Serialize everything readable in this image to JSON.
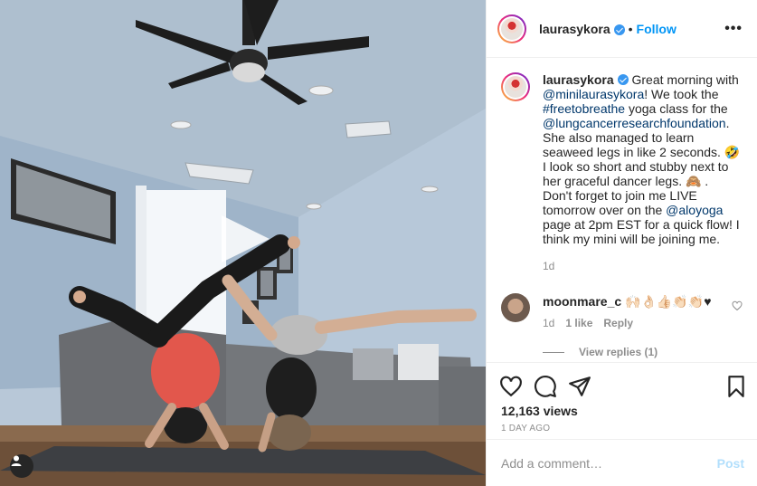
{
  "post": {
    "username": "laurasykora",
    "follow_label": "Follow",
    "more_label": "•••",
    "dot": "•"
  },
  "caption": {
    "username": "laurasykora",
    "p1": "Great morning with ",
    "m1": "@minilaurasykora",
    "p2": "! We took the ",
    "h1": "#freetobreathe",
    "p3": " yoga class for the ",
    "m2": "@lungcancerresearchfoundation",
    "p4": ". She also managed to learn seaweed legs in like 2 seconds. 🤣 I look so short and stubby next to her graceful dancer legs. 🙈 .",
    "p5": "Don't forget to join me LIVE tomorrow over on the ",
    "m3": "@aloyoga",
    "p6": " page at 2pm EST for a quick flow! I think my mini will be joining me.",
    "time": "1d"
  },
  "comment": {
    "username": "moonmare_c",
    "text": "🙌🏻👌🏻👍🏻👏🏻👏🏻♥",
    "time": "1d",
    "likes": "1 like",
    "reply_label": "Reply",
    "view_replies": "View replies (1)"
  },
  "stats": {
    "views": "12,163 views",
    "date": "1 DAY AGO"
  },
  "composer": {
    "placeholder": "Add a comment…",
    "post_label": "Post"
  },
  "colors": {
    "accent": "#0095f6",
    "link": "#00376b",
    "muted": "#8e8e8e",
    "post_disabled": "#b2dffc"
  },
  "icons": [
    "verified-badge-icon",
    "more-options-icon",
    "heart-icon",
    "comment-icon",
    "share-icon",
    "save-icon",
    "user-tag-icon"
  ]
}
